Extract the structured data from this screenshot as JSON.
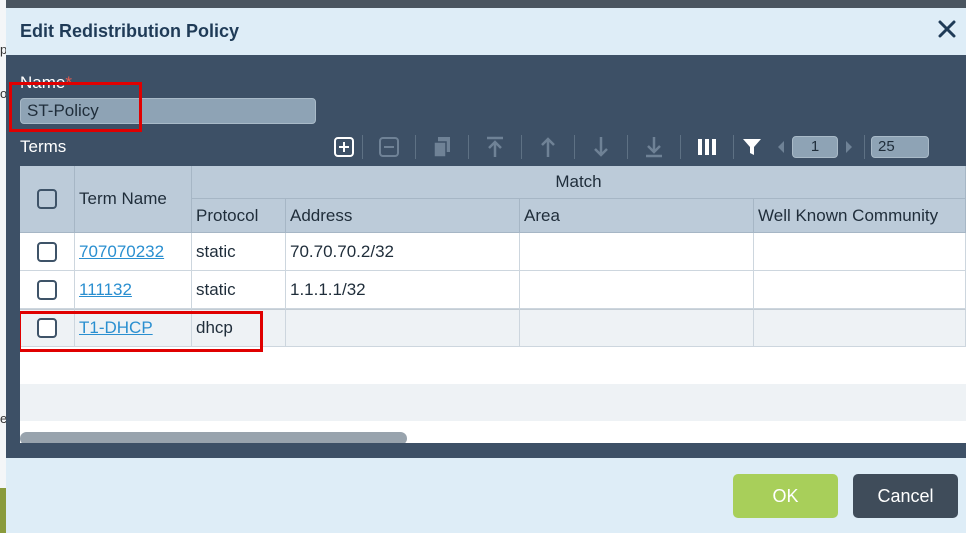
{
  "dialog": {
    "title": "Edit Redistribution Policy",
    "close_icon": "close-icon"
  },
  "name_field": {
    "label": "Name",
    "required_mark": "*",
    "value": "ST-Policy"
  },
  "terms": {
    "label": "Terms",
    "toolbar": {
      "icons": [
        "add-icon",
        "remove-icon",
        "copy-icon",
        "move-top-icon",
        "move-up-icon",
        "move-down-icon",
        "move-bottom-icon",
        "columns-icon",
        "filter-icon"
      ],
      "page": "1",
      "page_size": "25"
    },
    "columns": {
      "term_name": "Term Name",
      "match_group": "Match",
      "protocol": "Protocol",
      "address": "Address",
      "area": "Area",
      "well_known_community": "Well Known Community"
    },
    "rows": [
      {
        "term_name": "707070232",
        "protocol": "static",
        "address": "70.70.70.2/32",
        "area": "",
        "wkc": ""
      },
      {
        "term_name": "111132",
        "protocol": "static",
        "address": "1.1.1.1/32",
        "area": "",
        "wkc": ""
      },
      {
        "term_name": "T1-DHCP",
        "protocol": "dhcp",
        "address": "",
        "area": "",
        "wkc": ""
      }
    ]
  },
  "footer": {
    "ok_label": "OK",
    "cancel_label": "Cancel"
  },
  "colors": {
    "dialog_body": "#3d5066",
    "title_bar": "#deedf7",
    "ok_button": "#a8cf5a",
    "cancel_button": "#3f4c5a",
    "link": "#2a8fd0",
    "highlight": "#e00000"
  }
}
